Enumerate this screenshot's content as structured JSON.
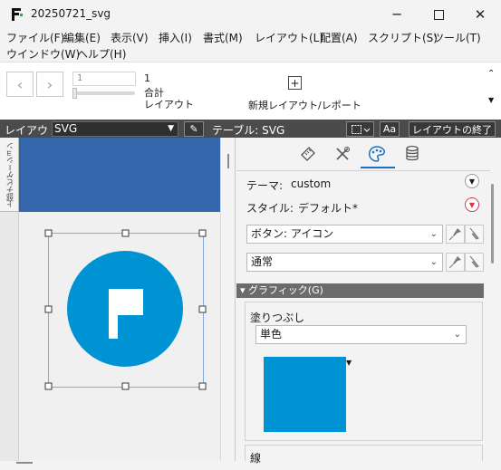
{
  "window": {
    "title": "20250721_svg"
  },
  "menu": {
    "row1": [
      "ファイル(F)",
      "編集(E)",
      "表示(V)",
      "挿入(I)",
      "書式(M)",
      "レイアウト(L)",
      "配置(A)",
      "スクリプト(S)",
      "ツール(T)"
    ],
    "row2": [
      "ウインドウ(W)",
      "ヘルプ(H)"
    ]
  },
  "toolbar": {
    "record_field": "1",
    "record_count": "1",
    "total_label": "合計",
    "layout_label": "レイアウト",
    "new_layout_label": "新規レイアウト/レポート"
  },
  "layout_bar": {
    "layout_label": "レイアウト:",
    "layout_value": "SVG",
    "table_label": "テーブル: SVG",
    "aa_label": "Aa",
    "exit_label": "レイアウトの終了"
  },
  "left_panel": {
    "nav_tab_label": "上部ナビゲーション"
  },
  "inspector": {
    "theme_label": "テーマ:",
    "theme_value": "custom",
    "style_label": "スタイル:",
    "style_value": "デフォルト*",
    "button_style": "ボタン: アイコン",
    "state": "通常",
    "graphic_section": "グラフィック(G)",
    "fill_label": "塗りつぶし",
    "fill_type": "単色",
    "line_label": "線"
  },
  "colors": {
    "header_band": "#3366aa",
    "icon_circle": "#0093d4",
    "fill_swatch": "#0093d4",
    "selection_handles": "#6b8fd6",
    "active_tab": "#1b6fc6"
  },
  "icons": {
    "flag_button": "flag-icon",
    "tabs": [
      "ruler-icon",
      "tools-icon",
      "palette-icon",
      "database-icon"
    ]
  }
}
